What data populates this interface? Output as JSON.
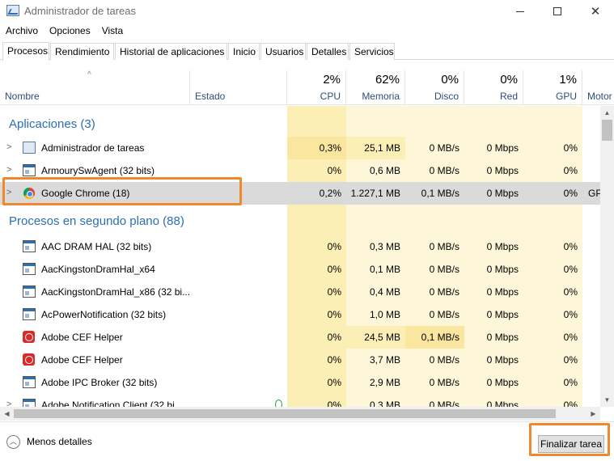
{
  "window": {
    "title": "Administrador de tareas",
    "menu": [
      "Archivo",
      "Opciones",
      "Vista"
    ],
    "tabs": [
      "Procesos",
      "Rendimiento",
      "Historial de aplicaciones",
      "Inicio",
      "Usuarios",
      "Detalles",
      "Servicios"
    ],
    "active_tab": "Procesos"
  },
  "header": {
    "name": "Nombre",
    "estado": "Estado",
    "cpu": {
      "pct": "2%",
      "label": "CPU"
    },
    "memoria": {
      "pct": "62%",
      "label": "Memoria"
    },
    "disco": {
      "pct": "0%",
      "label": "Disco"
    },
    "red": {
      "pct": "0%",
      "label": "Red"
    },
    "gpu": {
      "pct": "1%",
      "label": "GPU"
    },
    "motor": "Motor"
  },
  "groups": {
    "apps": "Aplicaciones (3)",
    "background": "Procesos en segundo plano (88)"
  },
  "apps": [
    {
      "name": "Administrador de tareas",
      "icon": "task-manager-icon",
      "cpu": "0,3%",
      "mem": "25,1 MB",
      "disk": "0 MB/s",
      "net": "0 Mbps",
      "gpu": "0%"
    },
    {
      "name": "ArmourySwAgent (32 bits)",
      "icon": "window-icon",
      "cpu": "0%",
      "mem": "0,6 MB",
      "disk": "0 MB/s",
      "net": "0 Mbps",
      "gpu": "0%"
    },
    {
      "name": "Google Chrome (18)",
      "icon": "chrome-icon",
      "cpu": "0,2%",
      "mem": "1.227,1 MB",
      "disk": "0,1 MB/s",
      "net": "0 Mbps",
      "gpu": "0%",
      "engine": "GP"
    }
  ],
  "background": [
    {
      "name": "AAC DRAM HAL (32 bits)",
      "icon": "window-icon",
      "cpu": "0%",
      "mem": "0,3 MB",
      "disk": "0 MB/s",
      "net": "0 Mbps",
      "gpu": "0%"
    },
    {
      "name": "AacKingstonDramHal_x64",
      "icon": "window-icon",
      "cpu": "0%",
      "mem": "0,1 MB",
      "disk": "0 MB/s",
      "net": "0 Mbps",
      "gpu": "0%"
    },
    {
      "name": "AacKingstonDramHal_x86 (32 bi...",
      "icon": "window-icon",
      "cpu": "0%",
      "mem": "0,4 MB",
      "disk": "0 MB/s",
      "net": "0 Mbps",
      "gpu": "0%"
    },
    {
      "name": "AcPowerNotification (32 bits)",
      "icon": "window-icon",
      "cpu": "0%",
      "mem": "1,0 MB",
      "disk": "0 MB/s",
      "net": "0 Mbps",
      "gpu": "0%"
    },
    {
      "name": "Adobe CEF Helper",
      "icon": "adobe-icon",
      "cpu": "0%",
      "mem": "24,5 MB",
      "disk": "0,1 MB/s",
      "net": "0 Mbps",
      "gpu": "0%"
    },
    {
      "name": "Adobe CEF Helper",
      "icon": "adobe-icon",
      "cpu": "0%",
      "mem": "3,7 MB",
      "disk": "0 MB/s",
      "net": "0 Mbps",
      "gpu": "0%"
    },
    {
      "name": "Adobe IPC Broker (32 bits)",
      "icon": "window-icon",
      "cpu": "0%",
      "mem": "2,9 MB",
      "disk": "0 MB/s",
      "net": "0 Mbps",
      "gpu": "0%"
    },
    {
      "name": "Adobe Notification Client (32 bi...",
      "icon": "window-icon",
      "cpu": "0%",
      "mem": "0,3 MB",
      "disk": "0 MB/s",
      "net": "0 Mbps",
      "gpu": "0%"
    }
  ],
  "footer": {
    "less_details": "Menos detalles",
    "end_task": "Finalizar tarea"
  },
  "colors": {
    "accent": "#2c6fb5",
    "metric_bg": "#fdf6d8",
    "metric_bg_strong": "#fbefb5",
    "highlight_row": "#dadada",
    "annotation": "#f0892c"
  }
}
